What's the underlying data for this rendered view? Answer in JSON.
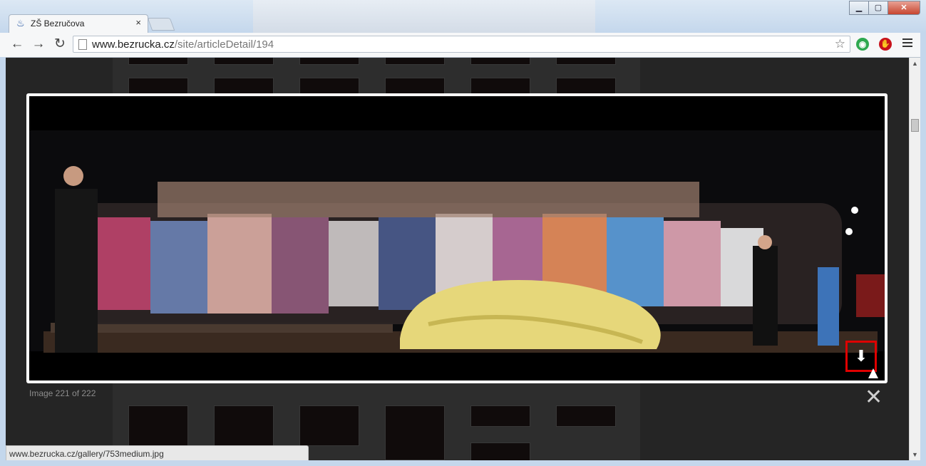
{
  "browser": {
    "tab_title": "ZŠ Bezručova",
    "tab_close": "×",
    "url_domain": "www.bezrucka.cz",
    "url_path": "/site/articleDetail/194",
    "window_buttons": {
      "minimize": "▁",
      "maximize": "▢",
      "close": "✕"
    },
    "back": "←",
    "forward": "→",
    "reload": "↻",
    "star": "☆"
  },
  "lightbox": {
    "caption": "Image 221 of 222",
    "download_icon": "⬇",
    "close_icon": "✕"
  },
  "status_bar": {
    "text": "www.bezrucka.cz/gallery/753medium.jpg"
  },
  "colors": {
    "highlight": "#e00000",
    "ext_green": "#2ea84f",
    "ext_red": "#c8121b"
  }
}
